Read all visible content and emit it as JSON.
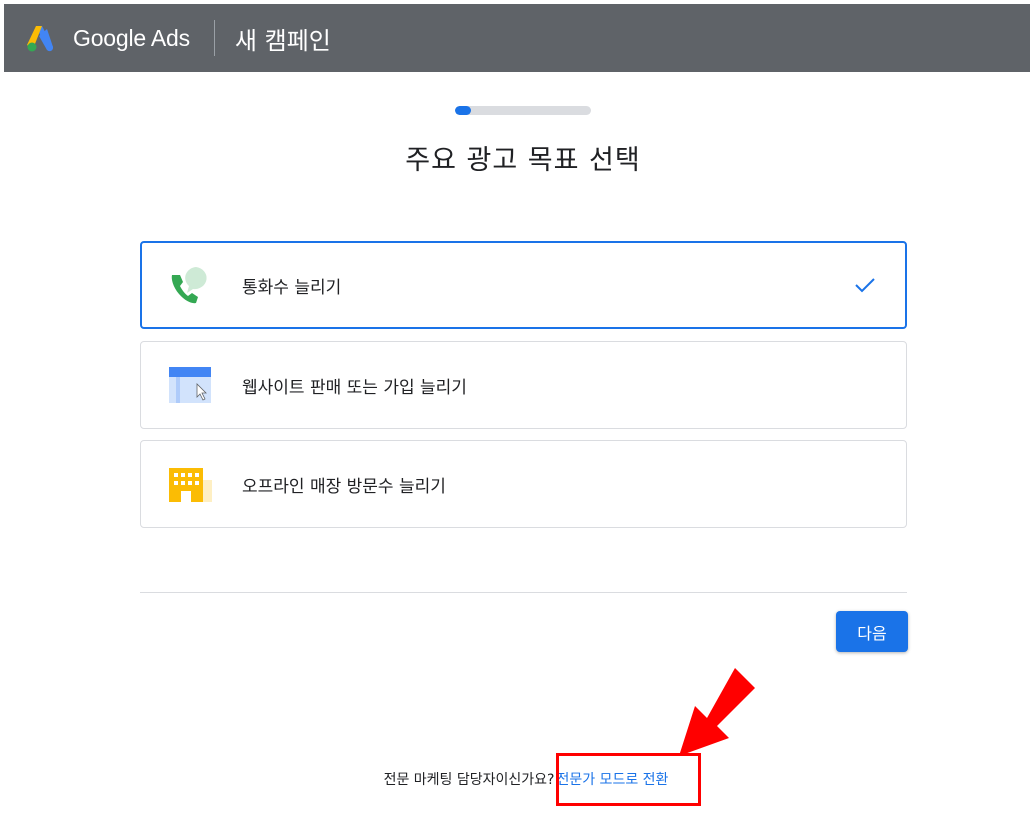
{
  "header": {
    "brand": "Google Ads",
    "title": "새 캠페인",
    "logo_icon": "google-ads-logo-icon"
  },
  "progress": {
    "fraction": 0.12
  },
  "main": {
    "title": "주요 광고 목표 선택",
    "options": [
      {
        "label": "통화수 늘리기",
        "icon": "phone-call-icon",
        "selected": true
      },
      {
        "label": "웹사이트 판매 또는 가입 늘리기",
        "icon": "website-icon",
        "selected": false
      },
      {
        "label": "오프라인 매장 방문수 늘리기",
        "icon": "store-icon",
        "selected": false
      }
    ],
    "next_label": "다음"
  },
  "footer": {
    "question": "전문 마케팅 담당자이신가요?",
    "link": "전문가 모드로 전환"
  },
  "colors": {
    "header_bg": "#5f6368",
    "accent": "#1a73e8",
    "annotation": "#ff0000"
  }
}
